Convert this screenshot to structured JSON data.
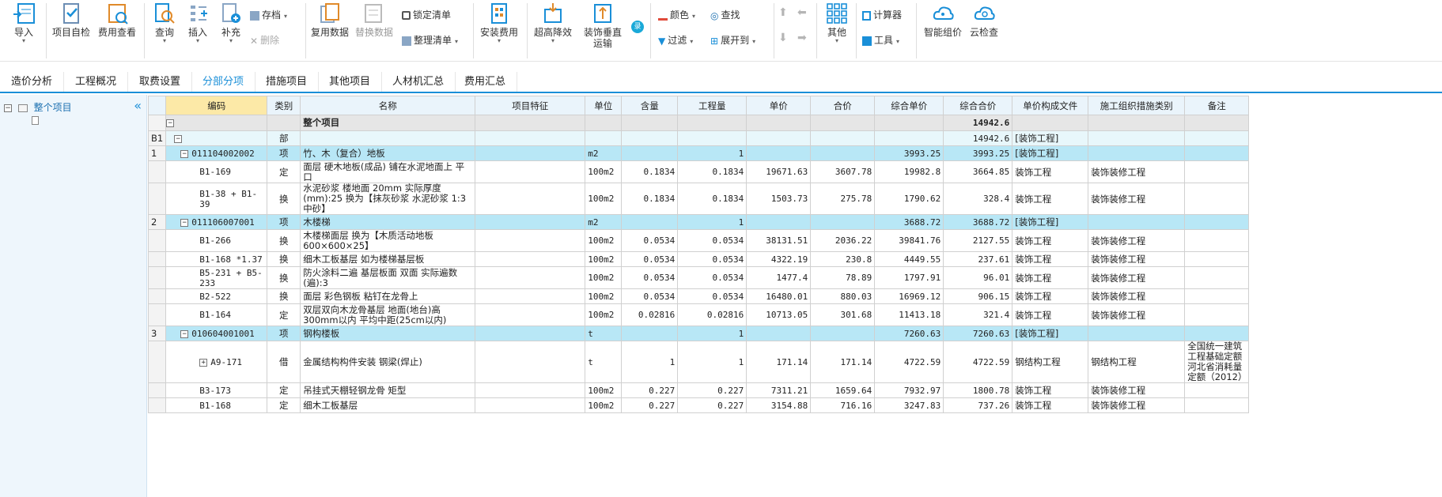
{
  "ribbon": {
    "import": "导入",
    "self_check": "项目自检",
    "fee_view": "费用查看",
    "query": "查询",
    "insert": "插入",
    "supplement": "补充",
    "save": "存档",
    "delete": "删除",
    "reuse_data": "复用数据",
    "replace_data": "替换数据",
    "lock_list": "锁定清单",
    "organize_list": "整理清单",
    "install_fee": "安装费用",
    "height_reduction": "超高降效",
    "decor_transport_l1": "装饰垂直",
    "decor_transport_l2": "运输",
    "badge": "录",
    "color": "颜色",
    "find": "查找",
    "filter": "过滤",
    "expand_to": "展开到",
    "other": "其他",
    "calculator": "计算器",
    "tools": "工具",
    "smart_price": "智能组价",
    "cloud_check": "云检查"
  },
  "tabs": [
    "造价分析",
    "工程概况",
    "取费设置",
    "分部分项",
    "措施项目",
    "其他项目",
    "人材机汇总",
    "费用汇总"
  ],
  "active_tab": "分部分项",
  "tree": {
    "root": "整个项目"
  },
  "columns": [
    "编码",
    "类别",
    "名称",
    "项目特征",
    "单位",
    "含量",
    "工程量",
    "单价",
    "合价",
    "综合单价",
    "综合合价",
    "单价构成文件",
    "施工组织措施类别",
    "备注"
  ],
  "rows": [
    {
      "kind": "root",
      "hdr": "",
      "code": "",
      "type": "",
      "name": "整个项目",
      "feat": "",
      "unit": "",
      "content": "",
      "qty": "",
      "price": "",
      "total": "",
      "cprice": "",
      "ctotal": "14942.6",
      "file": "",
      "cat": "",
      "note": ""
    },
    {
      "kind": "bu",
      "hdr": "B1",
      "code": "",
      "type": "部",
      "name": "",
      "feat": "",
      "unit": "",
      "content": "",
      "qty": "",
      "price": "",
      "total": "",
      "cprice": "",
      "ctotal": "14942.6",
      "file": "[装饰工程]",
      "cat": "",
      "note": ""
    },
    {
      "kind": "item",
      "hdr": "1",
      "code": "011104002002",
      "type": "项",
      "name": "竹、木（复合）地板",
      "feat": "",
      "unit": "m2",
      "content": "",
      "qty": "1",
      "price": "",
      "total": "",
      "cprice": "3993.25",
      "ctotal": "3993.25",
      "file": "[装饰工程]",
      "cat": "",
      "note": ""
    },
    {
      "kind": "q",
      "hdr": "",
      "code": "B1-169",
      "type": "定",
      "name": "面层 硬木地板(成品) 铺在水泥地面上 平口",
      "feat": "",
      "unit": "100m2",
      "content": "0.1834",
      "qty": "0.1834",
      "price": "19671.63",
      "total": "3607.78",
      "cprice": "19982.8",
      "ctotal": "3664.85",
      "file": "装饰工程",
      "cat": "装饰装修工程",
      "note": ""
    },
    {
      "kind": "q",
      "hdr": "",
      "code": "B1-38 + B1-39",
      "type": "换",
      "name": "水泥砂浆 楼地面 20mm  实际厚度(mm):25  换为【抹灰砂浆 水泥砂浆 1:3 中砂】",
      "feat": "",
      "unit": "100m2",
      "content": "0.1834",
      "qty": "0.1834",
      "price": "1503.73",
      "total": "275.78",
      "cprice": "1790.62",
      "ctotal": "328.4",
      "file": "装饰工程",
      "cat": "装饰装修工程",
      "note": ""
    },
    {
      "kind": "item",
      "hdr": "2",
      "code": "011106007001",
      "type": "项",
      "name": "木楼梯",
      "feat": "",
      "unit": "m2",
      "content": "",
      "qty": "1",
      "price": "",
      "total": "",
      "cprice": "3688.72",
      "ctotal": "3688.72",
      "file": "[装饰工程]",
      "cat": "",
      "note": ""
    },
    {
      "kind": "q",
      "hdr": "",
      "code": "B1-266",
      "type": "换",
      "name": "木楼梯面层  换为【木质活动地板 600×600×25】",
      "feat": "",
      "unit": "100m2",
      "content": "0.0534",
      "qty": "0.0534",
      "price": "38131.51",
      "total": "2036.22",
      "cprice": "39841.76",
      "ctotal": "2127.55",
      "file": "装饰工程",
      "cat": "装饰装修工程",
      "note": ""
    },
    {
      "kind": "q",
      "hdr": "",
      "code": "B1-168 *1.37",
      "type": "换",
      "name": "细木工板基层  如为楼梯基层板",
      "feat": "",
      "unit": "100m2",
      "content": "0.0534",
      "qty": "0.0534",
      "price": "4322.19",
      "total": "230.8",
      "cprice": "4449.55",
      "ctotal": "237.61",
      "file": "装饰工程",
      "cat": "装饰装修工程",
      "note": ""
    },
    {
      "kind": "q",
      "hdr": "",
      "code": "B5-231 + B5-233",
      "type": "换",
      "name": "防火涂料二遍 基层板面 双面  实际遍数(遍):3",
      "feat": "",
      "unit": "100m2",
      "content": "0.0534",
      "qty": "0.0534",
      "price": "1477.4",
      "total": "78.89",
      "cprice": "1797.91",
      "ctotal": "96.01",
      "file": "装饰工程",
      "cat": "装饰装修工程",
      "note": ""
    },
    {
      "kind": "q",
      "hdr": "",
      "code": "B2-522",
      "type": "换",
      "name": "面层 彩色钢板 粘钉在龙骨上",
      "feat": "",
      "unit": "100m2",
      "content": "0.0534",
      "qty": "0.0534",
      "price": "16480.01",
      "total": "880.03",
      "cprice": "16969.12",
      "ctotal": "906.15",
      "file": "装饰工程",
      "cat": "装饰装修工程",
      "note": ""
    },
    {
      "kind": "q",
      "hdr": "",
      "code": "B1-164",
      "type": "定",
      "name": "双层双向木龙骨基层 地面(地台)高300mm以内 平均中距(25cm以内)",
      "feat": "",
      "unit": "100m2",
      "content": "0.02816",
      "qty": "0.02816",
      "price": "10713.05",
      "total": "301.68",
      "cprice": "11413.18",
      "ctotal": "321.4",
      "file": "装饰工程",
      "cat": "装饰装修工程",
      "note": ""
    },
    {
      "kind": "item",
      "hdr": "3",
      "code": "010604001001",
      "type": "项",
      "name": "钢构楼板",
      "feat": "",
      "unit": "t",
      "content": "",
      "qty": "1",
      "price": "",
      "total": "",
      "cprice": "7260.63",
      "ctotal": "7260.63",
      "file": "[装饰工程]",
      "cat": "",
      "note": ""
    },
    {
      "kind": "q",
      "hdr": "",
      "code": "A9-171",
      "type": "借",
      "name": "金属结构构件安装 钢梁(焊止)",
      "feat": "",
      "unit": "t",
      "content": "1",
      "qty": "1",
      "price": "171.14",
      "total": "171.14",
      "cprice": "4722.59",
      "ctotal": "4722.59",
      "file": "钢结构工程",
      "cat": "钢结构工程",
      "note": "全国统一建筑工程基础定额河北省消耗量定额（2012）"
    },
    {
      "kind": "q",
      "hdr": "",
      "code": "B3-173",
      "type": "定",
      "name": "吊挂式天棚轻钢龙骨 矩型",
      "feat": "",
      "unit": "100m2",
      "content": "0.227",
      "qty": "0.227",
      "price": "7311.21",
      "total": "1659.64",
      "cprice": "7932.97",
      "ctotal": "1800.78",
      "file": "装饰工程",
      "cat": "装饰装修工程",
      "note": ""
    },
    {
      "kind": "q",
      "hdr": "",
      "code": "B1-168",
      "type": "定",
      "name": "细木工板基层",
      "feat": "",
      "unit": "100m2",
      "content": "0.227",
      "qty": "0.227",
      "price": "3154.88",
      "total": "716.16",
      "cprice": "3247.83",
      "ctotal": "737.26",
      "file": "装饰工程",
      "cat": "装饰装修工程",
      "note": ""
    }
  ],
  "colors": {
    "accent": "#1a8fd8",
    "item_row": "#b8e7f6",
    "header_sel": "#fce9a7"
  }
}
